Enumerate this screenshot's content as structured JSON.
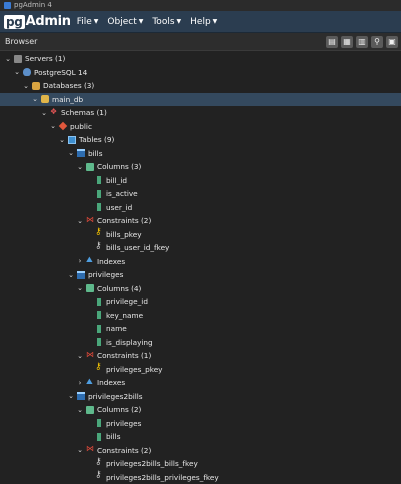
{
  "window": {
    "title": "pgAdmin 4"
  },
  "menubar": {
    "logo_pg": "pg",
    "logo_rest": "Admin",
    "items": [
      "File",
      "Object",
      "Tools",
      "Help"
    ]
  },
  "browser": {
    "title": "Browser"
  },
  "tree": [
    {
      "level": 0,
      "twist": "expanded",
      "icon": "servers",
      "label": "Servers (1)"
    },
    {
      "level": 1,
      "twist": "expanded",
      "icon": "pg",
      "label": "PostgreSQL 14"
    },
    {
      "level": 2,
      "twist": "expanded",
      "icon": "databases",
      "label": "Databases (3)"
    },
    {
      "level": 3,
      "twist": "expanded",
      "icon": "db",
      "label": "main_db",
      "selected": true
    },
    {
      "level": 4,
      "twist": "expanded",
      "icon": "schemas",
      "label": "Schemas (1)"
    },
    {
      "level": 5,
      "twist": "expanded",
      "icon": "schema",
      "label": "public"
    },
    {
      "level": 6,
      "twist": "expanded",
      "icon": "tables",
      "label": "Tables (9)"
    },
    {
      "level": 7,
      "twist": "expanded",
      "icon": "table",
      "label": "bills"
    },
    {
      "level": 8,
      "twist": "expanded",
      "icon": "columns",
      "label": "Columns (3)"
    },
    {
      "level": 9,
      "twist": "none",
      "icon": "column",
      "label": "bill_id"
    },
    {
      "level": 9,
      "twist": "none",
      "icon": "column",
      "label": "is_active"
    },
    {
      "level": 9,
      "twist": "none",
      "icon": "column",
      "label": "user_id"
    },
    {
      "level": 8,
      "twist": "expanded",
      "icon": "constraints",
      "label": "Constraints (2)"
    },
    {
      "level": 9,
      "twist": "none",
      "icon": "pkey",
      "label": "bills_pkey"
    },
    {
      "level": 9,
      "twist": "none",
      "icon": "fkey",
      "label": "bills_user_id_fkey"
    },
    {
      "level": 8,
      "twist": "collapsed",
      "icon": "indexes",
      "label": "Indexes"
    },
    {
      "level": 7,
      "twist": "expanded",
      "icon": "table",
      "label": "privileges"
    },
    {
      "level": 8,
      "twist": "expanded",
      "icon": "columns",
      "label": "Columns (4)"
    },
    {
      "level": 9,
      "twist": "none",
      "icon": "column",
      "label": "privilege_id"
    },
    {
      "level": 9,
      "twist": "none",
      "icon": "column",
      "label": "key_name"
    },
    {
      "level": 9,
      "twist": "none",
      "icon": "column",
      "label": "name"
    },
    {
      "level": 9,
      "twist": "none",
      "icon": "column",
      "label": "is_displaying"
    },
    {
      "level": 8,
      "twist": "expanded",
      "icon": "constraints",
      "label": "Constraints (1)"
    },
    {
      "level": 9,
      "twist": "none",
      "icon": "pkey",
      "label": "privileges_pkey"
    },
    {
      "level": 8,
      "twist": "collapsed",
      "icon": "indexes",
      "label": "Indexes"
    },
    {
      "level": 7,
      "twist": "expanded",
      "icon": "table",
      "label": "privileges2bills"
    },
    {
      "level": 8,
      "twist": "expanded",
      "icon": "columns",
      "label": "Columns (2)"
    },
    {
      "level": 9,
      "twist": "none",
      "icon": "column",
      "label": "privileges"
    },
    {
      "level": 9,
      "twist": "none",
      "icon": "column",
      "label": "bills"
    },
    {
      "level": 8,
      "twist": "expanded",
      "icon": "constraints",
      "label": "Constraints (2)"
    },
    {
      "level": 9,
      "twist": "none",
      "icon": "fkey",
      "label": "privileges2bills_bills_fkey"
    },
    {
      "level": 9,
      "twist": "none",
      "icon": "fkey",
      "label": "privileges2bills_privileges_fkey"
    }
  ]
}
